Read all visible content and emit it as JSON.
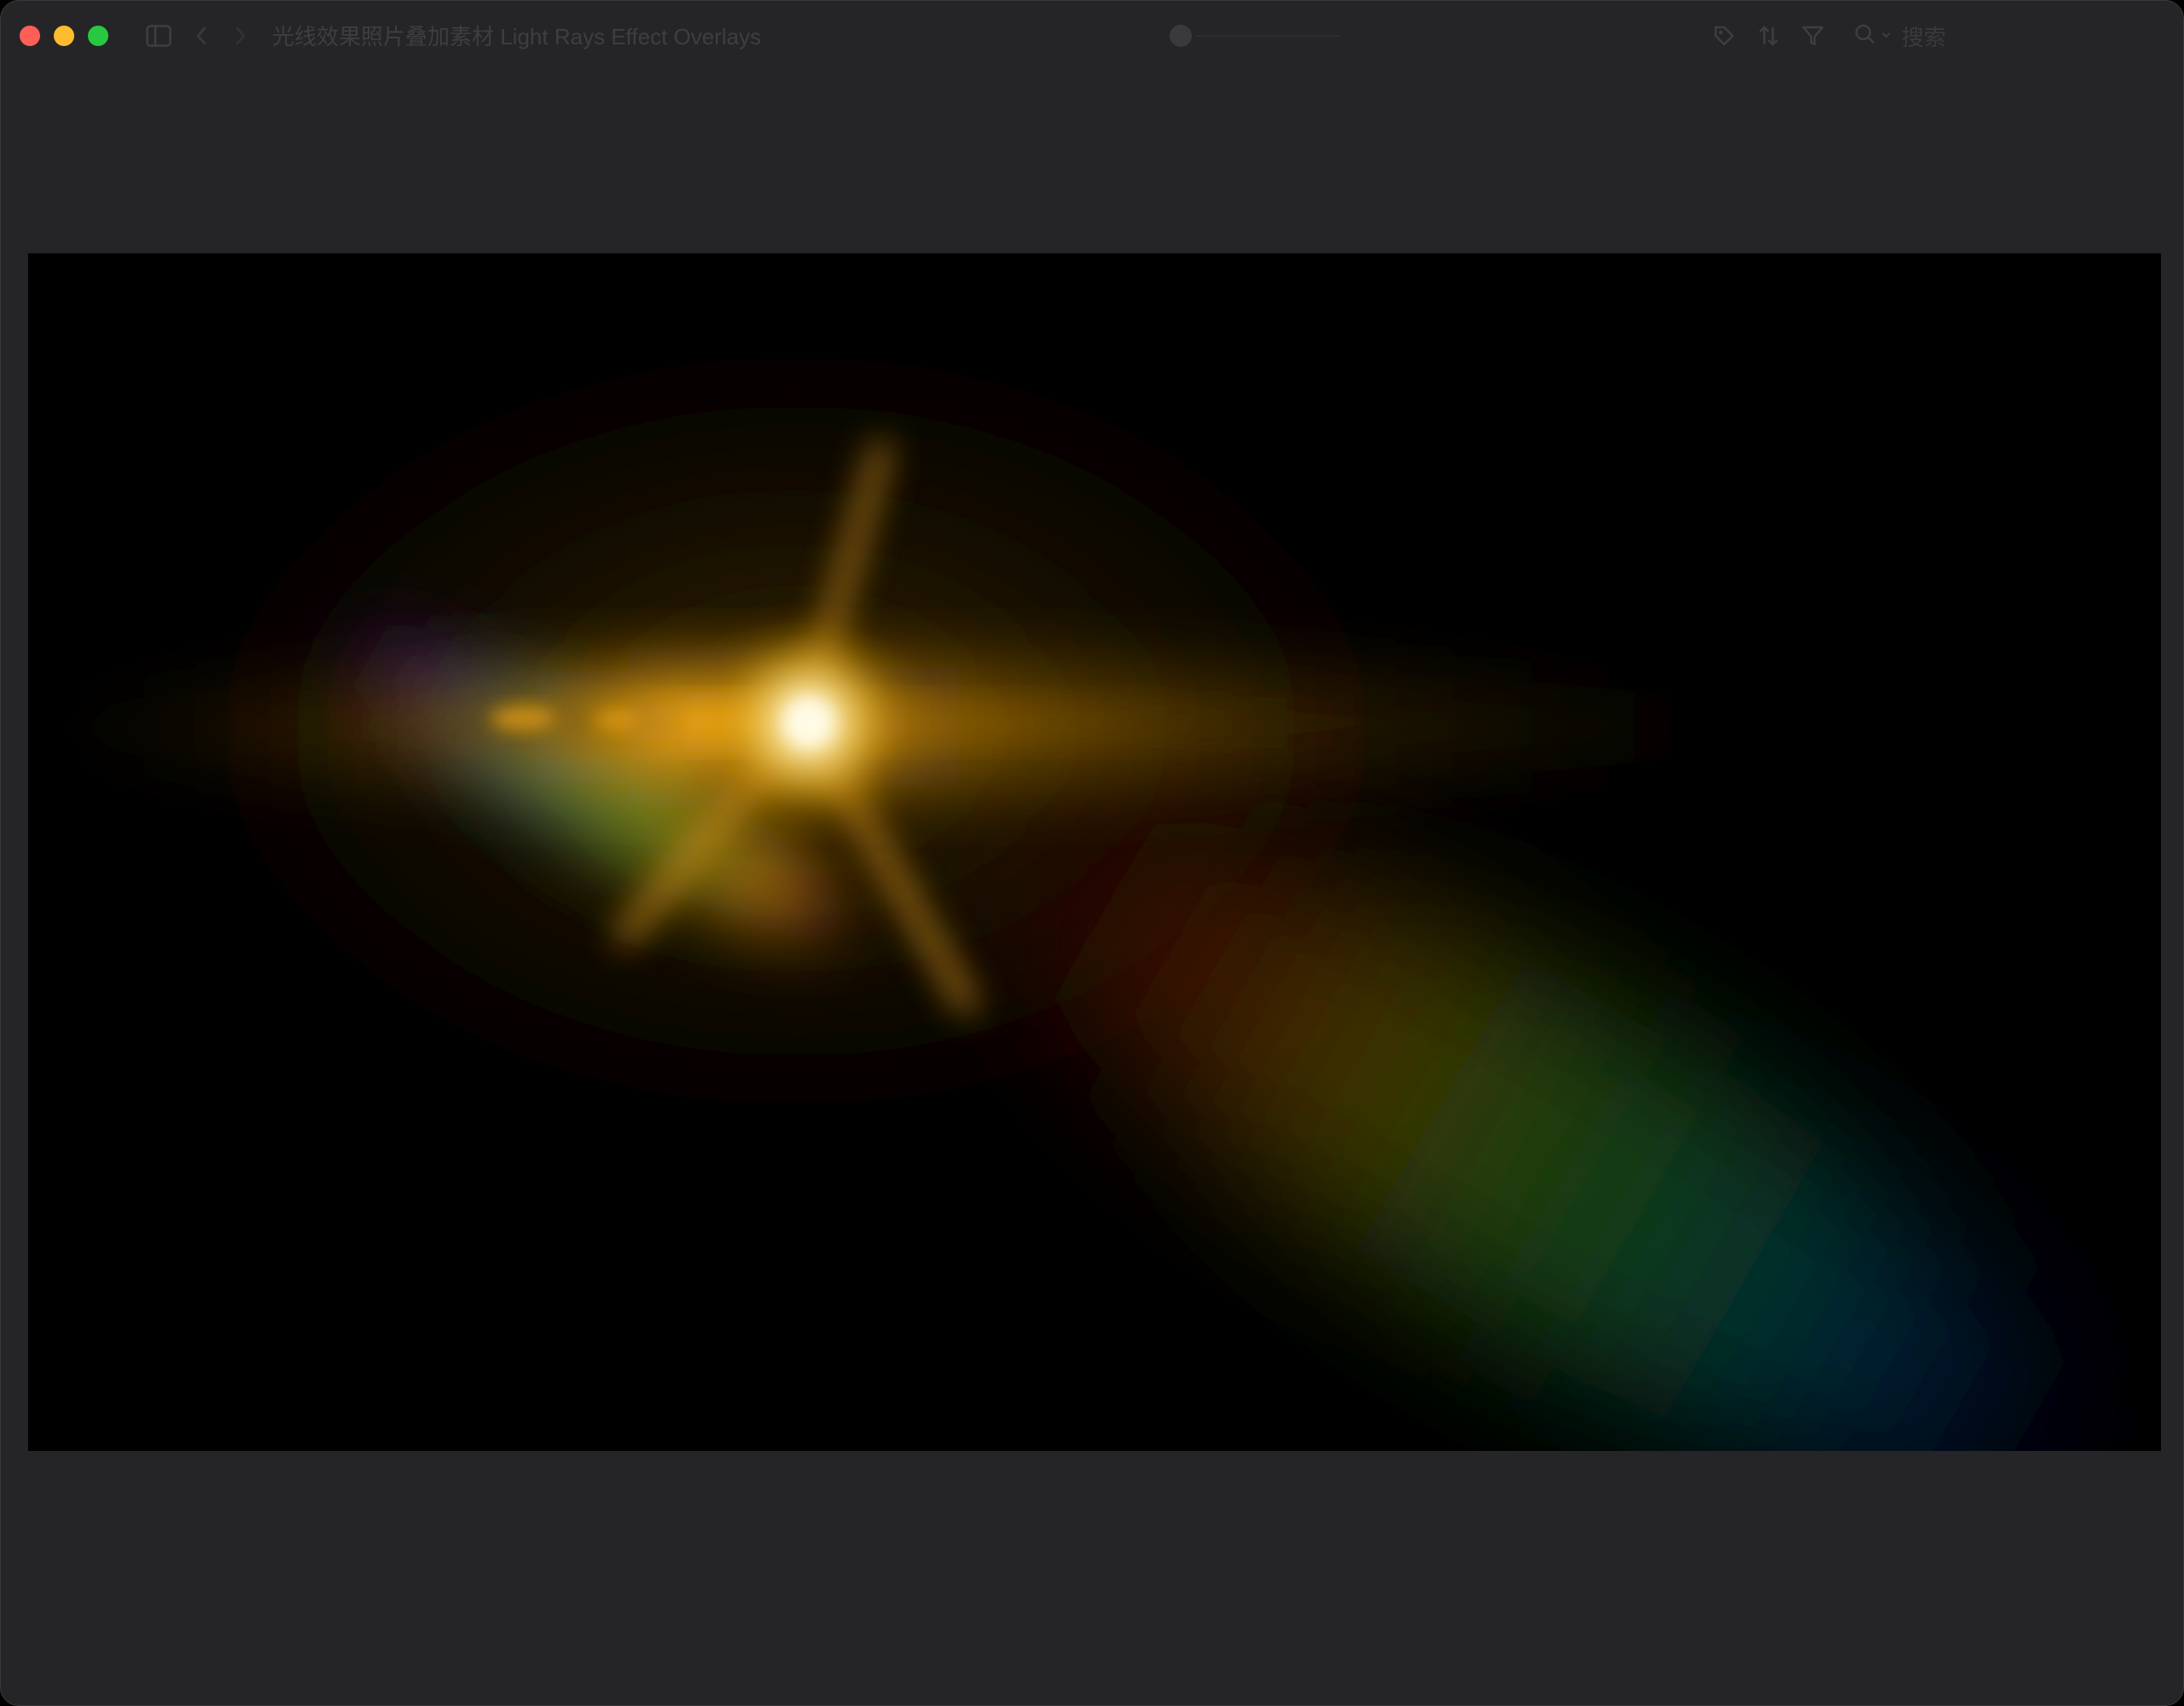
{
  "window": {
    "title": "光线效果照片叠加素材 Light Rays Effect Overlays"
  },
  "toolbar": {
    "search_placeholder": "搜索",
    "icons": [
      "sidebar-icon",
      "chevron-left-icon",
      "chevron-right-icon",
      "tag-icon",
      "sort-icon",
      "filter-icon",
      "search-icon",
      "chevron-down-icon"
    ]
  },
  "viewer": {
    "content": "lens flare image",
    "colors": {
      "flare_core": "#fff6c8",
      "flare_gold": "#f0a818",
      "background": "#000000",
      "window_bg": "#252527"
    }
  }
}
